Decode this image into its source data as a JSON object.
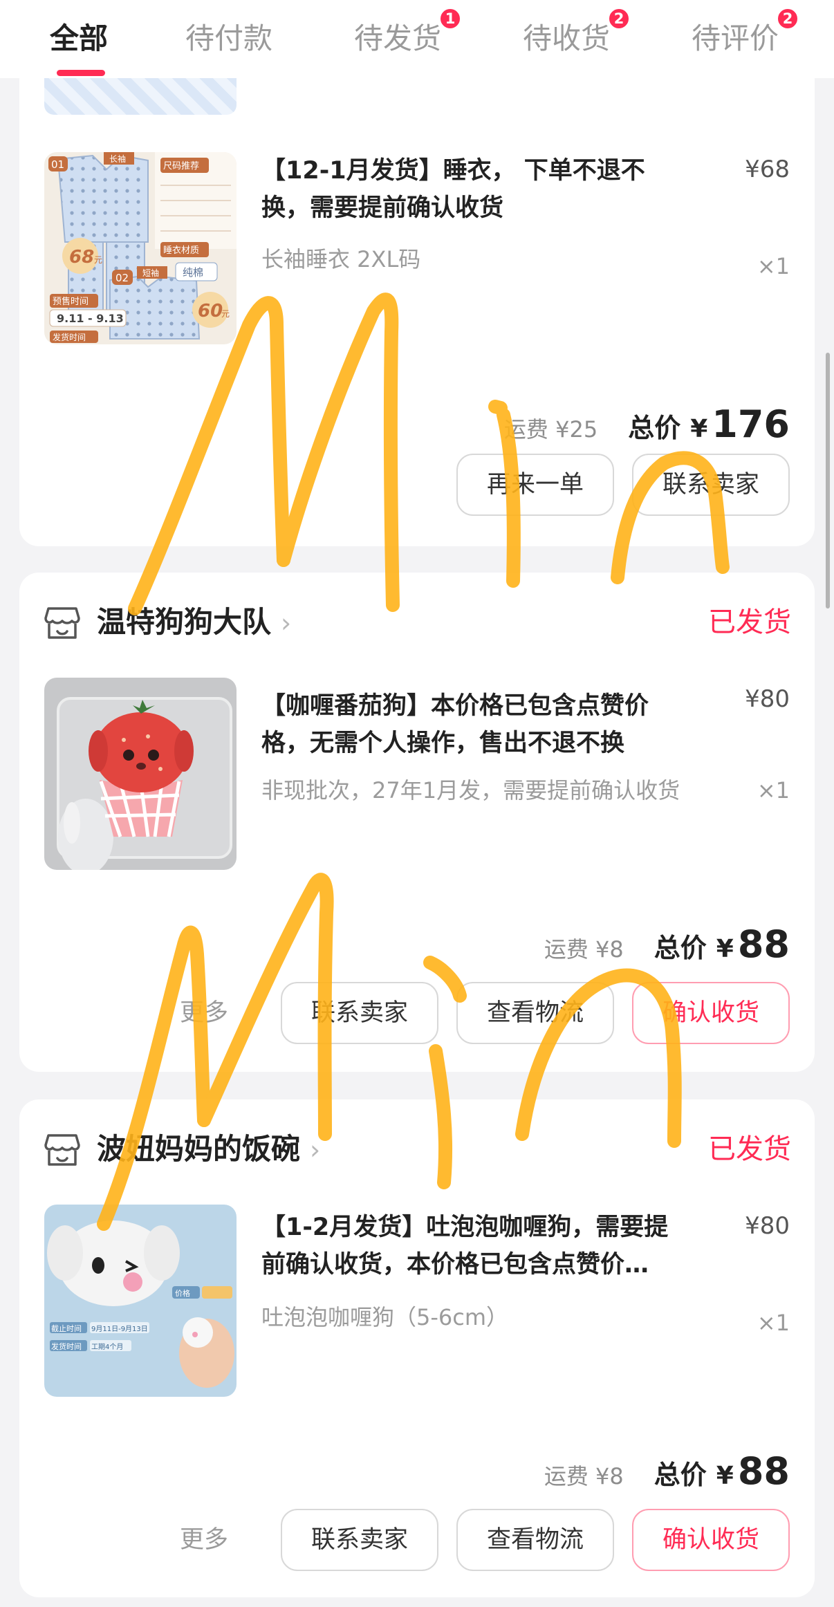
{
  "tabs": [
    {
      "label": "全部",
      "badge": ""
    },
    {
      "label": "待付款",
      "badge": ""
    },
    {
      "label": "待发货",
      "badge": "1"
    },
    {
      "label": "待收货",
      "badge": "2"
    },
    {
      "label": "待评价",
      "badge": "2"
    }
  ],
  "orders": [
    {
      "shop": null,
      "status": null,
      "product": {
        "title": "【12-1月发货】睡衣， 下单不退不换，需要提前确认收货",
        "price": "¥68",
        "spec": "长袖睡衣 2XL码",
        "qty": "×1",
        "thumb_text": {
          "tag1": "01",
          "tag2": "02",
          "price1": "68",
          "price1_unit": "元",
          "price2": "60",
          "price2_unit": "元",
          "date": "9.11 - 9.13",
          "label_presale": "预售时间",
          "label_ship": "发货时间",
          "label_size": "尺码推荐",
          "label_material": "睡衣材质",
          "label_cotton": "纯棉",
          "label_long": "长袖",
          "label_short": "短袖"
        }
      },
      "shipping": "运费 ¥25",
      "total_label": "总价",
      "total_yen": "¥",
      "total_amount": "176",
      "buttons": [
        "再来一单",
        "联系卖家"
      ]
    },
    {
      "shop": "温特狗狗大队",
      "status": "已发货",
      "product": {
        "title": "【咖喱番茄狗】本价格已包含点赞价格，无需个人操作，售出不退不换",
        "price": "¥80",
        "spec": "非现批次，27年1月发，需要提前确认收货",
        "qty": "×1"
      },
      "shipping": "运费 ¥8",
      "total_label": "总价",
      "total_yen": "¥",
      "total_amount": "88",
      "more": "更多",
      "buttons": [
        "联系卖家",
        "查看物流",
        "确认收货"
      ]
    },
    {
      "shop": "波妞妈妈的饭碗",
      "status": "已发货",
      "product": {
        "title": "【1-2月发货】吐泡泡咖喱狗，需要提前确认收货，本价格已包含点赞价…",
        "price": "¥80",
        "spec": "吐泡泡咖喱狗（5-6cm）",
        "qty": "×1",
        "thumb_text": {
          "label_price": "价格",
          "label_deadline": "截止时间",
          "label_ship": "发货时间",
          "deadline_value": "9月11日-9月13日",
          "ship_value": "工期4个月"
        }
      },
      "shipping": "运费 ¥8",
      "total_label": "总价",
      "total_yen": "¥",
      "total_amount": "88",
      "more": "更多",
      "buttons": [
        "联系卖家",
        "查看物流",
        "确认收货"
      ]
    }
  ],
  "handwriting": "Min",
  "colors": {
    "accent": "#ff2b54",
    "doodle": "#ffb31a",
    "background": "#f3f3f5",
    "card": "#ffffff"
  }
}
